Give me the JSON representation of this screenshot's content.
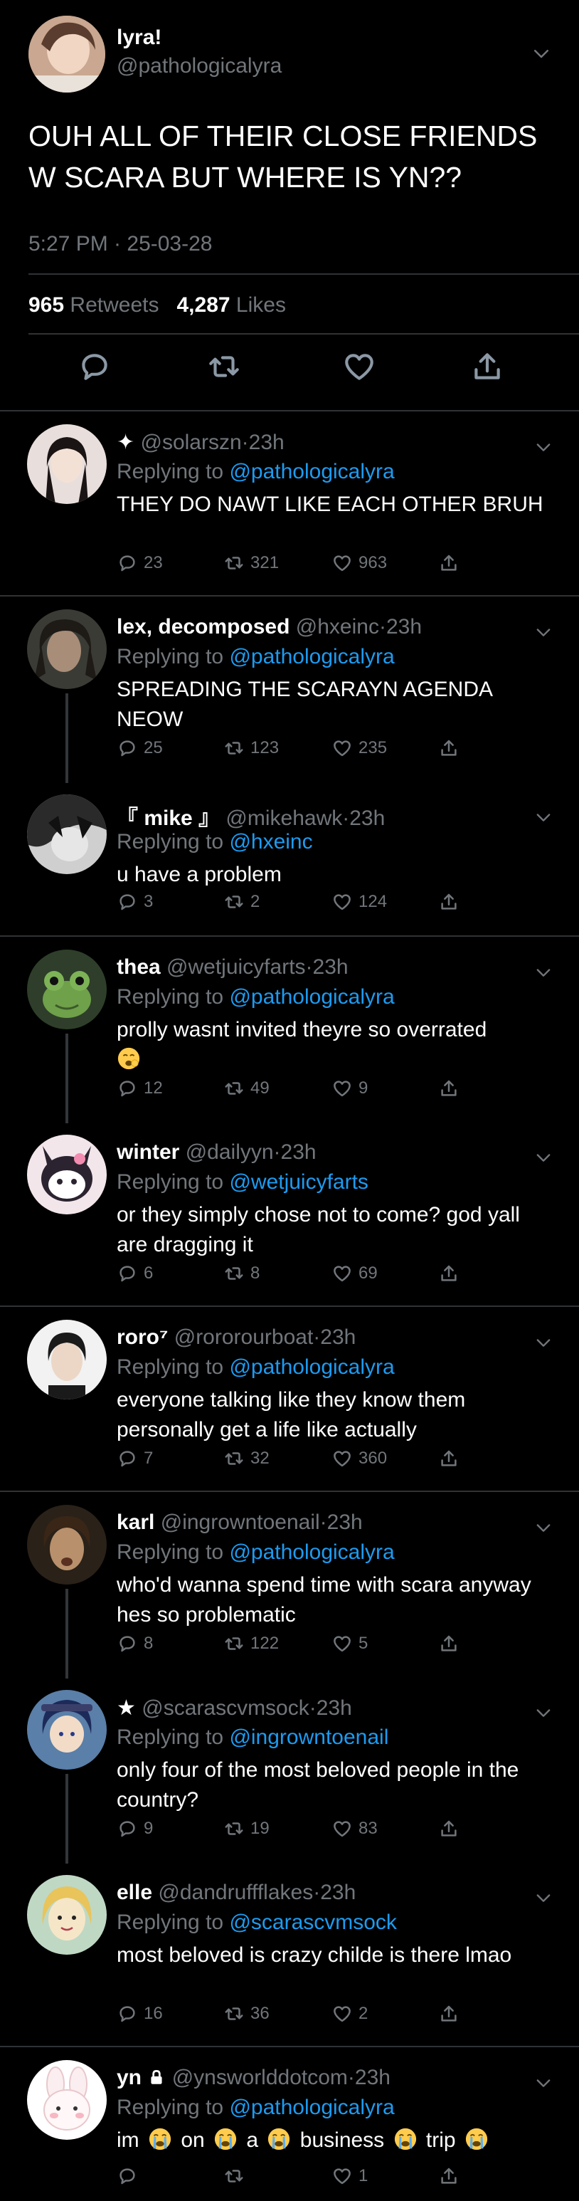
{
  "main_tweet": {
    "name": "lyra!",
    "handle": "@pathologicalyra",
    "text": "OUH ALL OF THEIR CLOSE FRIENDS W SCARA BUT WHERE IS YN??",
    "time": "5:27 PM · 25-03-28",
    "retweets_count": "965",
    "retweets_label": "Retweets",
    "likes_count": "4,287",
    "likes_label": "Likes"
  },
  "replies": [
    {
      "name": "✦",
      "handle": "@solarszn",
      "sep": "·",
      "time": "23h",
      "replying_label": "Replying to",
      "replying_to": "@pathologicalyra",
      "text": "THEY DO NAWT LIKE EACH OTHER BRUH",
      "reply_count": "23",
      "retweet_count": "321",
      "like_count": "963"
    },
    {
      "name": "lex, decomposed",
      "handle": "@hxeinc",
      "sep": "·",
      "time": "23h",
      "replying_label": "Replying to",
      "replying_to": "@pathologicalyra",
      "text": "SPREADING THE SCARAYN AGENDA NEOW",
      "reply_count": "25",
      "retweet_count": "123",
      "like_count": "235"
    },
    {
      "name": "『 mike 』",
      "handle": "@mikehawk",
      "sep": "·",
      "time": "23h",
      "replying_label": "Replying to",
      "replying_to": "@hxeinc",
      "text": "u have a problem",
      "reply_count": "3",
      "retweet_count": "2",
      "like_count": "124"
    },
    {
      "name": "thea",
      "handle": "@wetjuicyfarts",
      "sep": "·",
      "time": "23h",
      "replying_label": "Replying to",
      "replying_to": "@pathologicalyra",
      "text": "prolly wasnt invited theyre so overrated",
      "reply_count": "12",
      "retweet_count": "49",
      "like_count": "9"
    },
    {
      "name": "winter",
      "handle": "@dailyyn",
      "sep": "·",
      "time": "23h",
      "replying_label": "Replying to",
      "replying_to": "@wetjuicyfarts",
      "text": "or they simply chose not to come? god yall are dragging it",
      "reply_count": "6",
      "retweet_count": "8",
      "like_count": "69"
    },
    {
      "name": "roro⁷",
      "handle": "@rororourboat",
      "sep": "·",
      "time": "23h",
      "replying_label": "Replying to",
      "replying_to": "@pathologicalyra",
      "text": "everyone talking like they know them personally get a life like actually",
      "reply_count": "7",
      "retweet_count": "32",
      "like_count": "360"
    },
    {
      "name": "karl",
      "handle": "@ingrowntoenail",
      "sep": "·",
      "time": "23h",
      "replying_label": "Replying to",
      "replying_to": "@pathologicalyra",
      "text": "who'd wanna spend time with scara anyway hes so problematic",
      "reply_count": "8",
      "retweet_count": "122",
      "like_count": "5"
    },
    {
      "name": "★",
      "handle": "@scarascvmsock",
      "sep": "·",
      "time": "23h",
      "replying_label": "Replying to",
      "replying_to": "@ingrowntoenail",
      "text": "only four of the most beloved people in the country?",
      "reply_count": "9",
      "retweet_count": "19",
      "like_count": "83"
    },
    {
      "name": "elle",
      "handle": "@dandruffflakes",
      "sep": "·",
      "time": "23h",
      "replying_label": "Replying to",
      "replying_to": "@scarascvmsock",
      "text": "most beloved is crazy childe is there lmao",
      "reply_count": "16",
      "retweet_count": "36",
      "like_count": "2"
    },
    {
      "name": "yn",
      "handle": "@ynsworlddotcom",
      "sep": "·",
      "time": "23h",
      "replying_label": "Replying to",
      "replying_to": "@pathologicalyra",
      "words": [
        "im",
        "on",
        "a",
        "business",
        "trip"
      ],
      "reply_count": "",
      "retweet_count": "",
      "like_count": "1"
    }
  ],
  "colors": {
    "background": "#000000",
    "text": "#ffffff",
    "secondary": "#71767b",
    "mention": "#1d9bf0",
    "divider": "#2f3336"
  },
  "icons": [
    "chevron-down-icon",
    "reply-icon",
    "retweet-icon",
    "like-icon",
    "share-icon",
    "lock-icon",
    "yawning-emoji",
    "crying-emoji"
  ]
}
